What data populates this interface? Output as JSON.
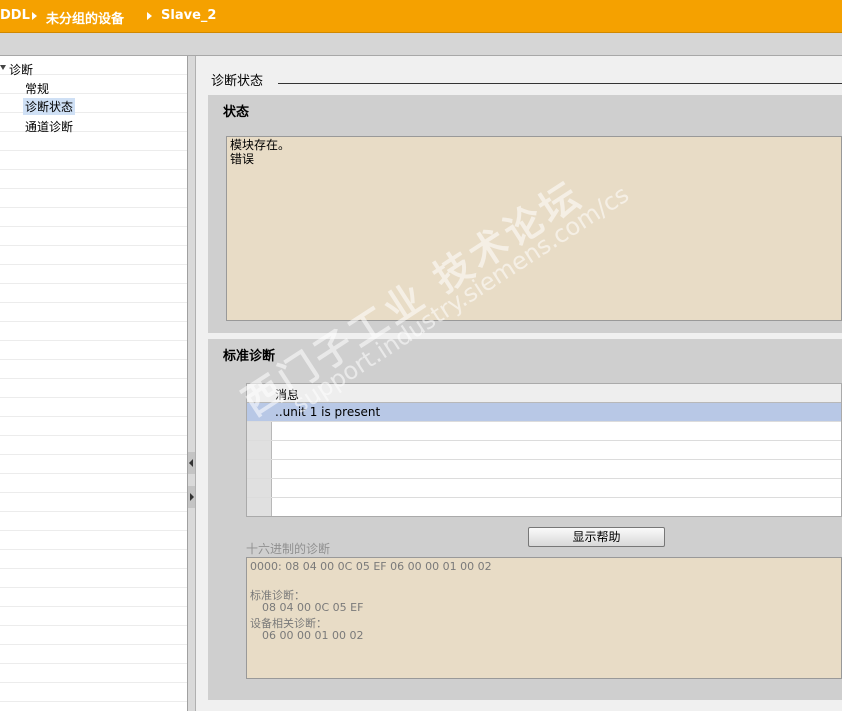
{
  "breadcrumb": {
    "items": [
      "DDL",
      "未分组的设备",
      "Slave_2"
    ]
  },
  "tree": {
    "root": "诊断",
    "items": [
      "常规",
      "诊断状态",
      "通道诊断"
    ],
    "selected": "诊断状态"
  },
  "main": {
    "section_title": "诊断状态",
    "status_panel": {
      "title": "状态",
      "lines": [
        "模块存在。",
        "错误"
      ]
    },
    "std_panel": {
      "title": "标准诊断",
      "table": {
        "header": "消息",
        "rows": [
          "..unit 1 is present"
        ]
      },
      "help_button": "显示帮助",
      "hex_label": "十六进制的诊断",
      "hex": {
        "line1": "0000:  08 04 00 0C 05 EF 06 00 00 01 00 02",
        "std_label": "标准诊断：",
        "std_bytes": "08 04 00 0C 05 EF",
        "dev_label": "设备相关诊断：",
        "dev_bytes": "06 00 00 01 00 02"
      }
    }
  },
  "watermark": {
    "line1": "西门子工业 技术论坛",
    "line2": "support.industry.siemens.com/cs"
  },
  "colors": {
    "titlebar": "#f5a100",
    "textbox_bg": "#e8dcc6",
    "selection": "#b8c8e6"
  }
}
